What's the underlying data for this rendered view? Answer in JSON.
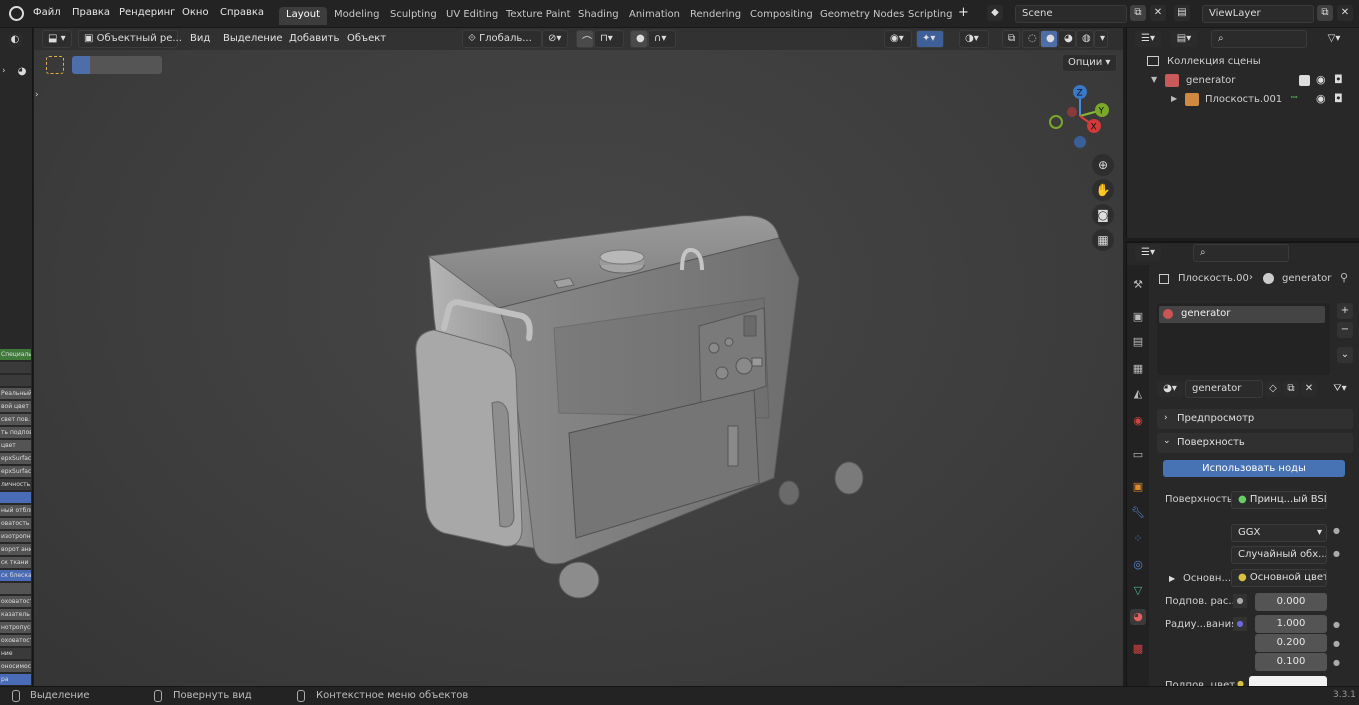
{
  "topbar": {
    "menus": [
      "Файл",
      "Правка",
      "Рендеринг",
      "Окно",
      "Справка"
    ],
    "workspaces": [
      "Layout",
      "Modeling",
      "Sculpting",
      "UV Editing",
      "Texture Paint",
      "Shading",
      "Animation",
      "Rendering",
      "Compositing",
      "Geometry Nodes",
      "Scripting"
    ],
    "active_workspace": "Layout",
    "add_workspace": "+",
    "scene": "Scene",
    "view_layer": "ViewLayer"
  },
  "viewport": {
    "mode": "Объектный ре...",
    "menus": [
      "Вид",
      "Выделение",
      "Добавить",
      "Объект"
    ],
    "transform_orientation": "Глобаль...",
    "options_label": "Опции",
    "gizmo": {
      "z": "Z",
      "y": "Y",
      "x": "X"
    }
  },
  "left_panel_items": [
    {
      "label": "Специальныый",
      "color": "#3f7a3a"
    },
    {
      "label": "",
      "color": "#3a3a3a"
    },
    {
      "label": "",
      "color": "#3a3a3a"
    },
    {
      "label": "Реальныйобход",
      "color": "#545454"
    },
    {
      "label": "вой цвет",
      "color": "#545454"
    },
    {
      "label": "свет пов. рассеи",
      "color": "#545454"
    },
    {
      "label": "ть подповерх",
      "color": "#545454"
    },
    {
      "label": "цвет",
      "color": "#545454"
    },
    {
      "label": "ерхSurfaceIOR",
      "color": "#545454"
    },
    {
      "label": "ерхSurfaceAniso",
      "color": "#545454"
    },
    {
      "label": "личность",
      "color": "#3a3a3a"
    },
    {
      "label": "",
      "color": "#4a6bb5"
    },
    {
      "label": "ный отблик",
      "color": "#545454"
    },
    {
      "label": "оватость",
      "color": "#545454"
    },
    {
      "label": "изотропность",
      "color": "#545454"
    },
    {
      "label": "ворот анизот",
      "color": "#545454"
    },
    {
      "label": "ск ткани",
      "color": "#545454"
    },
    {
      "label": "ск блеска",
      "color": "#4a6bb5"
    },
    {
      "label": "",
      "color": "#545454"
    },
    {
      "label": "оховатость",
      "color": "#545454"
    },
    {
      "label": "казатель пре",
      "color": "#545454"
    },
    {
      "label": "нотропуская",
      "color": "#545454"
    },
    {
      "label": "оховатость",
      "color": "#545454"
    },
    {
      "label": "ние",
      "color": "#3a3a3a"
    },
    {
      "label": "оносимость",
      "color": "#545454"
    },
    {
      "label": "ра",
      "color": "#4a6bb5"
    }
  ],
  "outliner": {
    "collection": "Коллекция сцены",
    "rows": [
      {
        "name": "generator",
        "level": 1
      },
      {
        "name": "Плоскость.001",
        "level": 2
      }
    ]
  },
  "properties": {
    "breadcrumb_object": "Плоскость.00",
    "breadcrumb_material": "generator",
    "material_slot": "generator",
    "material_name": "generator",
    "panel_preview": "Предпросмотр",
    "panel_surface": "Поверхность",
    "use_nodes_button": "Использовать ноды",
    "surface_label": "Поверхность",
    "surface_value": "Принц...ый BSDF",
    "distribution": "GGX",
    "subsurface_method": "Случайный обх...",
    "base_color_label": "Основн...",
    "base_color_value": "Основной цвет",
    "subsurface_label": "Подпов. рас...",
    "subsurface_value": "0.000",
    "radius_label": "Радиу...вания",
    "radius_values": [
      "1.000",
      "0.200",
      "0.100"
    ],
    "subsurface_color_label": "Подпов. цвет"
  },
  "statusbar": {
    "select": "Выделение",
    "rotate": "Повернуть вид",
    "context": "Контекстное меню объектов",
    "version": "3.3.1"
  }
}
